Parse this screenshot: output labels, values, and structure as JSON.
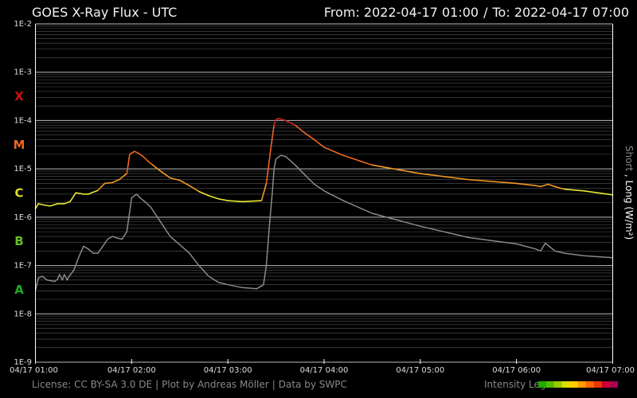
{
  "header": {
    "title": "GOES X-Ray Flux - UTC",
    "from_label": "From: 2022-04-17 01:00",
    "separator": "/",
    "to_label": "To: 2022-04-17 07:00"
  },
  "footer": {
    "license": "License: CC BY-SA 3.0 DE",
    "plot_by": "Plot by Andreas Möller",
    "data_by": "Data by SWPC",
    "separator": "|",
    "intensity_legend_label": "Intensity Leg",
    "intensity_colors": [
      "#22aa00",
      "#55bb00",
      "#99cc00",
      "#dddd00",
      "#ffcc00",
      "#ff9900",
      "#ff6600",
      "#ee3300",
      "#cc0033",
      "#aa0055"
    ]
  },
  "chart_data": {
    "type": "line",
    "title": "GOES X-Ray Flux - UTC",
    "ylabel_parts": {
      "short": "Short",
      "comma": " , ",
      "long": "Long (W/m²)"
    },
    "y_scale": "log",
    "ylim": [
      1e-09,
      0.01
    ],
    "y_tick_labels": [
      "1E-2",
      "1E-3",
      "1E-4",
      "1E-5",
      "1E-6",
      "1E-7",
      "1E-8",
      "1E-9"
    ],
    "x_tick_labels": [
      "04/17 01:00",
      "04/17 02:00",
      "04/17 03:00",
      "04/17 04:00",
      "04/17 05:00",
      "04/17 06:00",
      "04/17 07:00"
    ],
    "x_range_hours": [
      1,
      7
    ],
    "flare_classes": [
      {
        "label": "X",
        "color": "#cc1111"
      },
      {
        "label": "M",
        "color": "#ee6622"
      },
      {
        "label": "C",
        "color": "#dddd22"
      },
      {
        "label": "B",
        "color": "#66bb22"
      },
      {
        "label": "A",
        "color": "#22aa22"
      }
    ],
    "grid": true,
    "series": [
      {
        "name": "Long",
        "color_by_intensity": true,
        "x": [
          1.0,
          1.03,
          1.08,
          1.15,
          1.23,
          1.3,
          1.36,
          1.42,
          1.5,
          1.55,
          1.65,
          1.72,
          1.8,
          1.87,
          1.95,
          1.98,
          2.03,
          2.07,
          2.12,
          2.16,
          2.22,
          2.3,
          2.4,
          2.5,
          2.6,
          2.7,
          2.8,
          2.9,
          3.0,
          3.15,
          3.35,
          3.4,
          3.45,
          3.48,
          3.5,
          3.53,
          3.55,
          3.6,
          3.7,
          3.8,
          3.9,
          4.0,
          4.2,
          4.5,
          5.0,
          5.5,
          6.0,
          6.2,
          6.25,
          6.33,
          6.37,
          6.45,
          6.5,
          6.7,
          7.0
        ],
        "values": [
          1.5e-06,
          1.9e-06,
          1.8e-06,
          1.7e-06,
          1.9e-06,
          1.9e-06,
          2.1e-06,
          3.2e-06,
          3e-06,
          3e-06,
          3.6e-06,
          5e-06,
          5.2e-06,
          6e-06,
          8e-06,
          2e-05,
          2.3e-05,
          2.1e-05,
          1.8e-05,
          1.5e-05,
          1.2e-05,
          9e-06,
          6.5e-06,
          5.8e-06,
          4.5e-06,
          3.4e-06,
          2.8e-06,
          2.4e-06,
          2.2e-06,
          2.1e-06,
          2.2e-06,
          5e-06,
          3e-05,
          8e-05,
          0.000105,
          0.00011,
          0.000108,
          0.0001,
          8e-05,
          5.5e-05,
          4e-05,
          2.8e-05,
          1.9e-05,
          1.2e-05,
          8e-06,
          6e-06,
          5e-06,
          4.5e-06,
          4.3e-06,
          4.8e-06,
          4.5e-06,
          4e-06,
          3.8e-06,
          3.5e-06,
          2.9e-06
        ]
      },
      {
        "name": "Short",
        "color": "#8a8a8a",
        "x": [
          1.0,
          1.03,
          1.07,
          1.12,
          1.17,
          1.2,
          1.23,
          1.25,
          1.28,
          1.3,
          1.33,
          1.35,
          1.4,
          1.45,
          1.5,
          1.55,
          1.6,
          1.65,
          1.7,
          1.75,
          1.8,
          1.85,
          1.9,
          1.95,
          2.0,
          2.05,
          2.1,
          2.15,
          2.2,
          2.3,
          2.4,
          2.5,
          2.6,
          2.7,
          2.8,
          2.9,
          3.0,
          3.15,
          3.3,
          3.37,
          3.4,
          3.43,
          3.46,
          3.48,
          3.5,
          3.55,
          3.6,
          3.7,
          3.8,
          3.9,
          4.0,
          4.2,
          4.5,
          5.0,
          5.5,
          6.0,
          6.2,
          6.25,
          6.3,
          6.4,
          6.5,
          6.7,
          7.0
        ],
        "values": [
          3e-08,
          5.5e-08,
          6e-08,
          5e-08,
          4.8e-08,
          4.7e-08,
          5.2e-08,
          6.5e-08,
          5e-08,
          6.5e-08,
          5e-08,
          6e-08,
          8e-08,
          1.5e-07,
          2.5e-07,
          2.2e-07,
          1.8e-07,
          1.8e-07,
          2.5e-07,
          3.5e-07,
          4e-07,
          3.7e-07,
          3.5e-07,
          5e-07,
          2.5e-06,
          3e-06,
          2.4e-06,
          2e-06,
          1.6e-06,
          8e-07,
          4e-07,
          2.7e-07,
          1.8e-07,
          1e-07,
          6e-08,
          4.5e-08,
          4e-08,
          3.5e-08,
          3.3e-08,
          4e-08,
          1e-07,
          6e-07,
          3e-06,
          1e-05,
          1.6e-05,
          1.9e-05,
          1.8e-05,
          1.2e-05,
          7.5e-06,
          4.8e-06,
          3.5e-06,
          2.2e-06,
          1.2e-06,
          6.5e-07,
          3.8e-07,
          2.8e-07,
          2.2e-07,
          2e-07,
          2.9e-07,
          2e-07,
          1.8e-07,
          1.6e-07,
          1.45e-07
        ]
      }
    ]
  }
}
